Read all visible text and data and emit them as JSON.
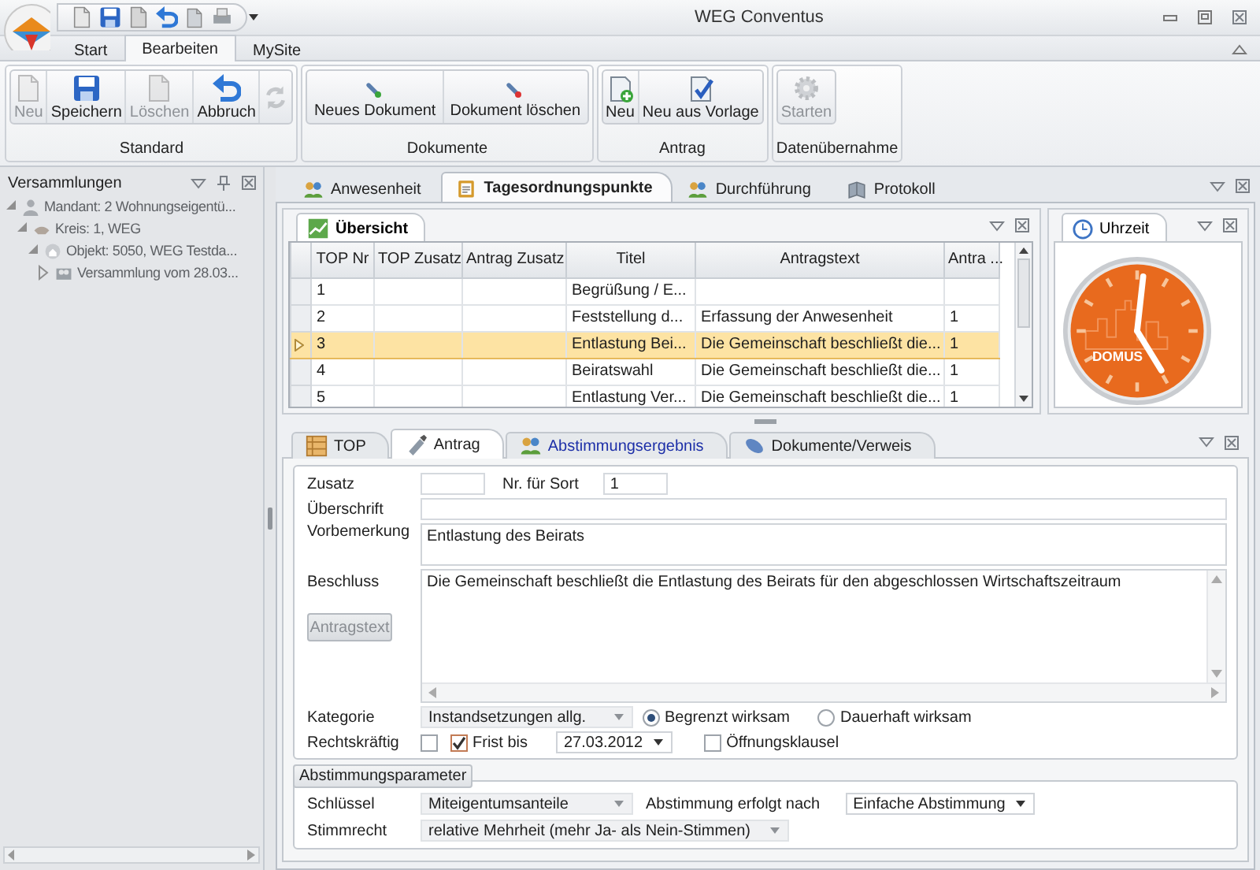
{
  "window": {
    "title": "WEG Conventus"
  },
  "ribbon": {
    "tabs": [
      {
        "label": "Start",
        "selected": false
      },
      {
        "label": "Bearbeiten",
        "selected": true
      },
      {
        "label": "MySite",
        "selected": false
      }
    ],
    "groups": [
      {
        "label": "Standard",
        "buttons": [
          {
            "label": "Neu",
            "disabled": true
          },
          {
            "label": "Speichern",
            "disabled": false
          },
          {
            "label": "Löschen",
            "disabled": true
          },
          {
            "label": "Abbruch",
            "disabled": false
          }
        ]
      },
      {
        "label": "Dokumente",
        "buttons": [
          {
            "label": "Neues Dokument",
            "disabled": false
          },
          {
            "label": "Dokument löschen",
            "disabled": false
          }
        ]
      },
      {
        "label": "Antrag",
        "buttons": [
          {
            "label": "Neu",
            "disabled": false
          },
          {
            "label": "Neu aus Vorlage",
            "disabled": false
          }
        ]
      },
      {
        "label": "Datenübernahme",
        "buttons": [
          {
            "label": "Starten",
            "disabled": true
          }
        ]
      }
    ]
  },
  "sidebar": {
    "title": "Versammlungen",
    "tree": [
      {
        "label": "Mandant: 2 Wohnungseigentü...",
        "expanded": true,
        "children": [
          {
            "label": "Kreis: 1, WEG",
            "expanded": true,
            "children": [
              {
                "label": "Objekt: 5050, WEG Testda...",
                "expanded": true,
                "children": [
                  {
                    "label": "Versammlung vom 28.03...",
                    "expanded": false
                  }
                ]
              }
            ]
          }
        ]
      }
    ]
  },
  "document_tabs": [
    {
      "label": "Anwesenheit",
      "selected": false
    },
    {
      "label": "Tagesordnungspunkte",
      "selected": true
    },
    {
      "label": "Durchführung",
      "selected": false
    },
    {
      "label": "Protokoll",
      "selected": false
    }
  ],
  "overview": {
    "title": "Übersicht",
    "table": {
      "columns": [
        "TOP Nr",
        "TOP Zusatz",
        "Antrag Zusatz",
        "Titel",
        "Antragstext",
        "Antra ..."
      ],
      "rows": [
        {
          "cells": [
            "1",
            "",
            "",
            "Begrüßung / E...",
            "",
            ""
          ],
          "selected": false
        },
        {
          "cells": [
            "2",
            "",
            "",
            "Feststellung d...",
            "Erfassung der Anwesenheit",
            "1"
          ],
          "selected": false
        },
        {
          "cells": [
            "3",
            "",
            "",
            "Entlastung Bei...",
            "Die Gemeinschaft beschließt die...",
            "1"
          ],
          "selected": true
        },
        {
          "cells": [
            "4",
            "",
            "",
            "Beiratswahl",
            "Die Gemeinschaft beschließt die...",
            "1"
          ],
          "selected": false
        },
        {
          "cells": [
            "5",
            "",
            "",
            "Entlastung Ver...",
            "Die Gemeinschaft beschließt die...",
            "1"
          ],
          "selected": false
        }
      ]
    }
  },
  "clock": {
    "title": "Uhrzeit",
    "brand": "DOMUS"
  },
  "detail_tabs": [
    {
      "label": "TOP",
      "selected": false,
      "kind": "tab"
    },
    {
      "label": "Antrag",
      "selected": true,
      "kind": "tab"
    },
    {
      "label": "Abstimmungsergebnis",
      "selected": false,
      "kind": "link"
    },
    {
      "label": "Dokumente/Verweis",
      "selected": false,
      "kind": "tab"
    }
  ],
  "form": {
    "zusatz": {
      "label": "Zusatz"
    },
    "sort": {
      "label": "Nr. für Sort",
      "value": "1"
    },
    "ueberschrift": {
      "label": "Überschrift"
    },
    "vorbemerkung": {
      "label": "Vorbemerkung",
      "value": "Entlastung des Beirats"
    },
    "beschluss": {
      "label": "Beschluss",
      "value": "Die Gemeinschaft beschließt die Entlastung des Beirats für den abgeschlossen Wirtschaftszeitraum"
    },
    "antragstext_button": {
      "label": "Antragstext",
      "disabled": true
    },
    "kategorie": {
      "label": "Kategorie",
      "value": "Instandsetzungen allg."
    },
    "wirksamkeit": [
      {
        "label": "Begrenzt wirksam",
        "selected": true
      },
      {
        "label": "Dauerhaft wirksam",
        "selected": false
      }
    ],
    "rechtskraeftig": {
      "label": "Rechtskräftig",
      "checked": false
    },
    "frist": {
      "label": "Frist bis",
      "checked": true,
      "value": "27.03.2012"
    },
    "oeffnungsklausel": {
      "label": "Öffnungsklausel",
      "checked": false
    }
  },
  "abstimmungsparameter": {
    "title": "Abstimmungsparameter",
    "schluessel": {
      "label": "Schlüssel",
      "value": "Miteigentumsanteile"
    },
    "verfahren": {
      "label": "Abstimmung erfolgt nach",
      "value": "Einfache Abstimmung"
    },
    "stimmrecht": {
      "label": "Stimmrecht",
      "value": "relative Mehrheit (mehr Ja- als Nein-Stimmen)"
    }
  }
}
